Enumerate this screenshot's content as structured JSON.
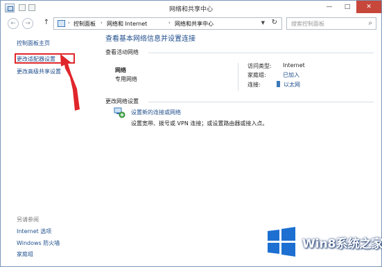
{
  "window": {
    "title": "网络和共享中心"
  },
  "title_buttons": {
    "minimize": "—",
    "maximize": "□",
    "close": "✕"
  },
  "nav": {
    "back": "←",
    "forward": "→",
    "up": "↑",
    "breadcrumbs": [
      "控制面板",
      "网络和 Internet",
      "网络和共享中心"
    ],
    "separator": "›",
    "search_placeholder": "搜索控制面板"
  },
  "sidebar": {
    "links": [
      "控制面板主页",
      "更改适配器设置",
      "更改高级共享设置"
    ],
    "see_also_title": "另请参阅",
    "see_also": [
      "Internet 选项",
      "Windows 防火墙",
      "家庭组"
    ]
  },
  "main": {
    "title": "查看基本网络信息并设置连接",
    "active_networks_title": "查看活动网络",
    "network_name": "网络",
    "network_profile": "专用网络",
    "access_type_label": "访问类型:",
    "access_type_value": "Internet",
    "homegroup_label": "家庭组:",
    "homegroup_value": "已加入",
    "connections_label": "连接:",
    "connections_value": "以太网",
    "change_settings_title": "更改网络设置",
    "setup_link": "设置新的连接或网络",
    "setup_desc": "设置宽带、拨号或 VPN 连接；或设置路由器或接入点。"
  },
  "annotation": {
    "highlight_color": "#e0262b"
  },
  "watermark": {
    "text": "Win8系统之家"
  },
  "colors": {
    "link": "#1e4d8c",
    "accent": "#e0262b",
    "close": "#c7473b"
  }
}
